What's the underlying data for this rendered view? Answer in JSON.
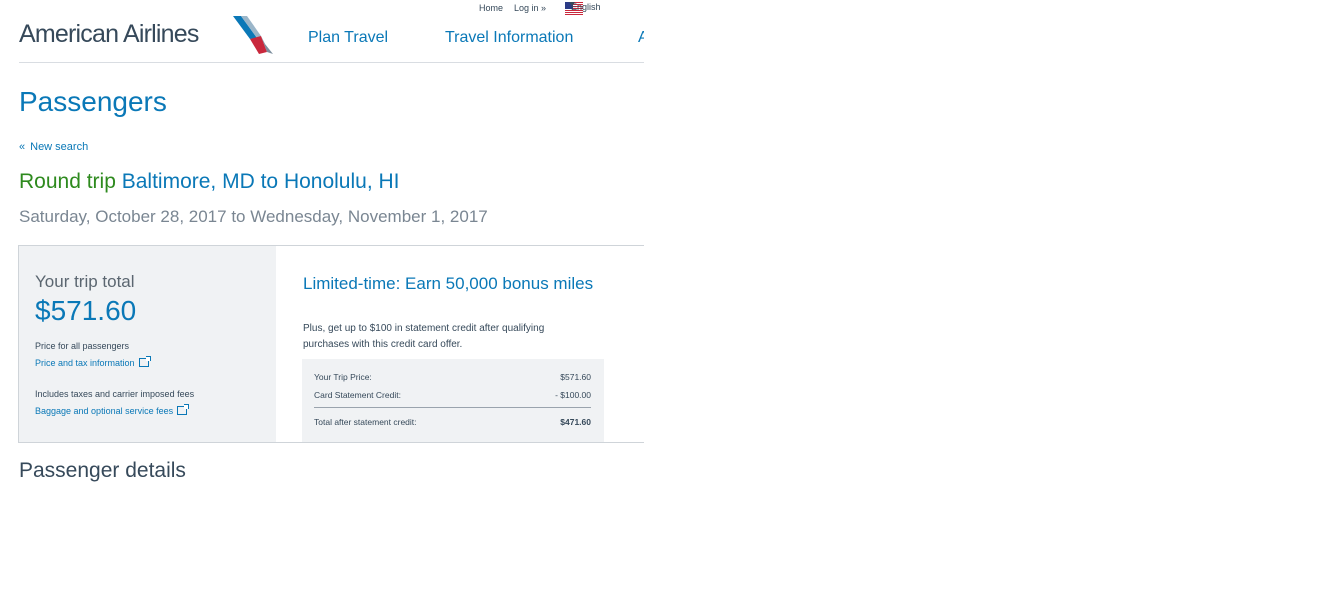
{
  "utility": {
    "home": "Home",
    "login": "Log in »",
    "language": "English"
  },
  "brand": {
    "name": "American Airlines",
    "colors": {
      "blue": "#0a78b7",
      "red": "#c9283c",
      "dark": "#36495a",
      "green": "#2e8a1e"
    }
  },
  "nav": {
    "plan_travel": "Plan Travel",
    "travel_information": "Travel Information",
    "truncated": "A"
  },
  "page": {
    "title": "Passengers",
    "back_link": "New search",
    "back_chevron": "«"
  },
  "trip": {
    "type": "Round trip",
    "route": "Baltimore, MD to Honolulu, HI",
    "dates": "Saturday, October 28, 2017 to Wednesday, November 1, 2017"
  },
  "summary": {
    "total_label": "Your trip total",
    "total_value": "$571.60",
    "price_note": "Price for all passengers",
    "price_tax_link": "Price and tax information",
    "fees_note": "Includes taxes and carrier imposed fees",
    "baggage_link": "Baggage and optional service fees"
  },
  "promo": {
    "title": "Limited-time: Earn 50,000 bonus miles",
    "text": "Plus, get up to $100 in statement credit after qualifying purchases with this credit card offer.",
    "rows": [
      {
        "label": "Your Trip Price:",
        "value": "$571.60"
      },
      {
        "label": "Card Statement Credit:",
        "value": "- $100.00"
      }
    ],
    "total": {
      "label": "Total after statement credit:",
      "value": "$471.60"
    }
  },
  "sections": {
    "passenger_details": "Passenger details"
  },
  "icons": [
    "us-flag-icon",
    "caret-down-icon",
    "external-link-icon",
    "aa-logo-icon"
  ]
}
